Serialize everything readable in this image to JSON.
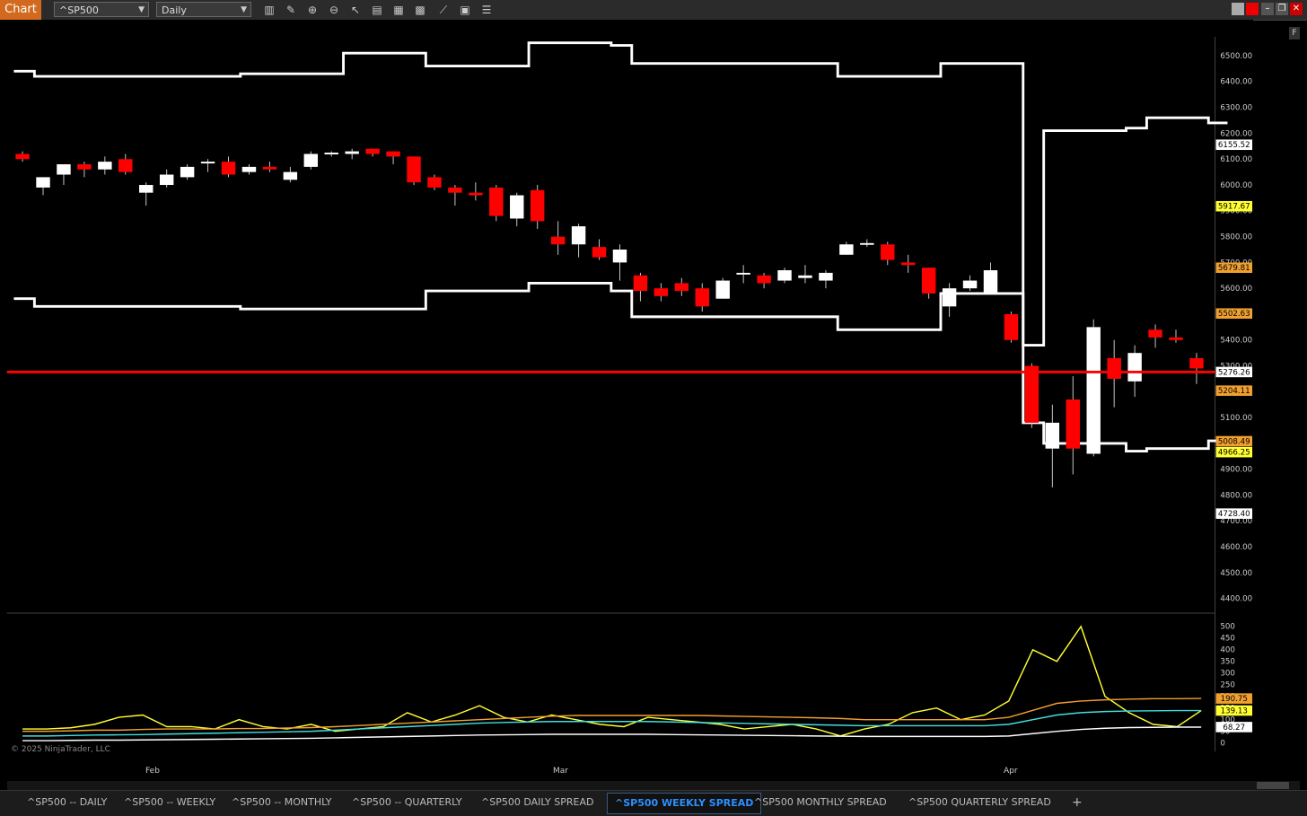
{
  "toolbar": {
    "app_label": "Chart",
    "instrument": "^SP500",
    "interval": "Daily",
    "right_button": "F"
  },
  "x_axis": {
    "labels": [
      "Feb",
      "Mar",
      "Apr"
    ]
  },
  "price_axis": {
    "ticks": [
      "6500.00",
      "6400.00",
      "6300.00",
      "6200.00",
      "6100.00",
      "6000.00",
      "5900.00",
      "5800.00",
      "5700.00",
      "5600.00",
      "5500.00",
      "5400.00",
      "5300.00",
      "5200.00",
      "5100.00",
      "5000.00",
      "4900.00",
      "4800.00",
      "4700.00",
      "4600.00",
      "4500.00",
      "4400.00"
    ],
    "tags": [
      {
        "text": "6155.52",
        "color": "#ffffff"
      },
      {
        "text": "5917.67",
        "color": "#ffff33"
      },
      {
        "text": "5679.81",
        "color": "#f0a030"
      },
      {
        "text": "5502.63",
        "color": "#f0a030"
      },
      {
        "text": "5276.26",
        "color": "#ffffff"
      },
      {
        "text": "5204.11",
        "color": "#f0a030"
      },
      {
        "text": "5008.49",
        "color": "#f0a030"
      },
      {
        "text": "4966.25",
        "color": "#ffff33"
      },
      {
        "text": "4728.40",
        "color": "#ffffff"
      }
    ]
  },
  "indicator_axis": {
    "ticks": [
      "500",
      "450",
      "400",
      "350",
      "300",
      "250",
      "200",
      "150",
      "100",
      "50",
      "0"
    ],
    "tags": [
      {
        "text": "190.75",
        "color": "#f0a030"
      },
      {
        "text": "139.13",
        "color": "#ffff33"
      },
      {
        "text": "68.27",
        "color": "#ffffff"
      }
    ]
  },
  "copyright": "© 2025 NinjaTrader, LLC",
  "tabs": [
    {
      "label": "^SP500 -- DAILY",
      "active": false
    },
    {
      "label": "^SP500 -- WEEKLY",
      "active": false
    },
    {
      "label": "^SP500 -- MONTHLY",
      "active": false
    },
    {
      "label": "^SP500 -- QUARTERLY",
      "active": false
    },
    {
      "label": "^SP500 DAILY SPREAD",
      "active": false
    },
    {
      "label": "^SP500 WEEKLY SPREAD",
      "active": true
    },
    {
      "label": "^SP500 MONTHLY SPREAD",
      "active": false
    },
    {
      "label": "^SP500 QUARTERLY SPREAD",
      "active": false
    }
  ],
  "add_tab": "+",
  "colors": {
    "up": "#ffffff",
    "down": "#ff0000",
    "level": "#ff0000",
    "band_white": "#ffffff",
    "band_yellow": "#ffff33",
    "band_orange": "#f0a030",
    "cyan": "#40e0e0"
  },
  "chart_data": {
    "type": "candlestick",
    "y_range": [
      4350,
      6560
    ],
    "current_price_line": 5276.26,
    "candles": [
      {
        "o": 6120,
        "h": 6130,
        "l": 6090,
        "c": 6100
      },
      {
        "o": 5990,
        "h": 6030,
        "l": 5960,
        "c": 6030
      },
      {
        "o": 6040,
        "h": 6080,
        "l": 6000,
        "c": 6080
      },
      {
        "o": 6080,
        "h": 6090,
        "l": 6030,
        "c": 6060
      },
      {
        "o": 6060,
        "h": 6110,
        "l": 6040,
        "c": 6090
      },
      {
        "o": 6100,
        "h": 6120,
        "l": 6040,
        "c": 6050
      },
      {
        "o": 5970,
        "h": 6010,
        "l": 5920,
        "c": 6000
      },
      {
        "o": 6000,
        "h": 6060,
        "l": 5990,
        "c": 6040
      },
      {
        "o": 6030,
        "h": 6080,
        "l": 6020,
        "c": 6070
      },
      {
        "o": 6090,
        "h": 6100,
        "l": 6050,
        "c": 6090
      },
      {
        "o": 6090,
        "h": 6110,
        "l": 6030,
        "c": 6040
      },
      {
        "o": 6050,
        "h": 6080,
        "l": 6040,
        "c": 6070
      },
      {
        "o": 6070,
        "h": 6090,
        "l": 6050,
        "c": 6060
      },
      {
        "o": 6020,
        "h": 6070,
        "l": 6010,
        "c": 6050
      },
      {
        "o": 6070,
        "h": 6130,
        "l": 6060,
        "c": 6120
      },
      {
        "o": 6120,
        "h": 6130,
        "l": 6110,
        "c": 6125
      },
      {
        "o": 6120,
        "h": 6140,
        "l": 6100,
        "c": 6130
      },
      {
        "o": 6140,
        "h": 6140,
        "l": 6110,
        "c": 6120
      },
      {
        "o": 6130,
        "h": 6130,
        "l": 6080,
        "c": 6110
      },
      {
        "o": 6110,
        "h": 6110,
        "l": 6000,
        "c": 6010
      },
      {
        "o": 6030,
        "h": 6040,
        "l": 5980,
        "c": 5990
      },
      {
        "o": 5990,
        "h": 6000,
        "l": 5920,
        "c": 5970
      },
      {
        "o": 5970,
        "h": 6010,
        "l": 5940,
        "c": 5960
      },
      {
        "o": 5990,
        "h": 6000,
        "l": 5860,
        "c": 5880
      },
      {
        "o": 5870,
        "h": 5970,
        "l": 5840,
        "c": 5960
      },
      {
        "o": 5980,
        "h": 6000,
        "l": 5830,
        "c": 5860
      },
      {
        "o": 5800,
        "h": 5860,
        "l": 5730,
        "c": 5770
      },
      {
        "o": 5770,
        "h": 5850,
        "l": 5720,
        "c": 5840
      },
      {
        "o": 5760,
        "h": 5790,
        "l": 5710,
        "c": 5720
      },
      {
        "o": 5700,
        "h": 5770,
        "l": 5630,
        "c": 5750
      },
      {
        "o": 5650,
        "h": 5660,
        "l": 5550,
        "c": 5590
      },
      {
        "o": 5600,
        "h": 5620,
        "l": 5550,
        "c": 5570
      },
      {
        "o": 5620,
        "h": 5640,
        "l": 5570,
        "c": 5590
      },
      {
        "o": 5600,
        "h": 5620,
        "l": 5510,
        "c": 5530
      },
      {
        "o": 5560,
        "h": 5640,
        "l": 5560,
        "c": 5630
      },
      {
        "o": 5660,
        "h": 5690,
        "l": 5620,
        "c": 5660
      },
      {
        "o": 5650,
        "h": 5660,
        "l": 5600,
        "c": 5620
      },
      {
        "o": 5630,
        "h": 5680,
        "l": 5620,
        "c": 5670
      },
      {
        "o": 5640,
        "h": 5690,
        "l": 5620,
        "c": 5650
      },
      {
        "o": 5630,
        "h": 5670,
        "l": 5600,
        "c": 5660
      },
      {
        "o": 5730,
        "h": 5780,
        "l": 5730,
        "c": 5770
      },
      {
        "o": 5770,
        "h": 5790,
        "l": 5760,
        "c": 5775
      },
      {
        "o": 5770,
        "h": 5780,
        "l": 5690,
        "c": 5710
      },
      {
        "o": 5700,
        "h": 5730,
        "l": 5660,
        "c": 5690
      },
      {
        "o": 5680,
        "h": 5680,
        "l": 5560,
        "c": 5580
      },
      {
        "o": 5530,
        "h": 5620,
        "l": 5490,
        "c": 5600
      },
      {
        "o": 5600,
        "h": 5650,
        "l": 5590,
        "c": 5630
      },
      {
        "o": 5580,
        "h": 5700,
        "l": 5580,
        "c": 5670
      },
      {
        "o": 5500,
        "h": 5510,
        "l": 5390,
        "c": 5400
      },
      {
        "o": 5300,
        "h": 5310,
        "l": 5060,
        "c": 5080
      },
      {
        "o": 4980,
        "h": 5150,
        "l": 4830,
        "c": 5080
      },
      {
        "o": 5170,
        "h": 5260,
        "l": 4880,
        "c": 4980
      },
      {
        "o": 4960,
        "h": 5480,
        "l": 4950,
        "c": 5450
      },
      {
        "o": 5330,
        "h": 5400,
        "l": 5140,
        "c": 5250
      },
      {
        "o": 5240,
        "h": 5380,
        "l": 5180,
        "c": 5350
      },
      {
        "o": 5440,
        "h": 5460,
        "l": 5370,
        "c": 5410
      },
      {
        "o": 5410,
        "h": 5440,
        "l": 5390,
        "c": 5400
      },
      {
        "o": 5330,
        "h": 5350,
        "l": 5230,
        "c": 5290
      }
    ],
    "bands": [
      {
        "color": "white",
        "x": [
          0,
          1,
          5,
          11,
          16,
          20,
          25,
          29,
          30,
          35,
          40,
          45,
          49,
          50,
          54,
          55,
          58
        ],
        "y": [
          6440,
          6420,
          6420,
          6430,
          6510,
          6460,
          6550,
          6540,
          6470,
          6470,
          6420,
          6470,
          5380,
          6210,
          6220,
          6260,
          6240
        ]
      },
      {
        "color": "white",
        "x": [
          0,
          1,
          5,
          11,
          16,
          20,
          25,
          29,
          30,
          35,
          40,
          45,
          49,
          50,
          54,
          55,
          58
        ],
        "y": [
          5560,
          5530,
          5530,
          5520,
          5520,
          5590,
          5620,
          5590,
          5490,
          5490,
          5440,
          5580,
          5080,
          5000,
          4970,
          4980,
          5010
        ]
      }
    ],
    "indicator": {
      "y_range": [
        0,
        520
      ],
      "series": [
        {
          "color": "#ffff33",
          "values": [
            60,
            60,
            65,
            80,
            110,
            120,
            70,
            70,
            60,
            100,
            70,
            60,
            80,
            50,
            60,
            70,
            130,
            90,
            120,
            160,
            110,
            90,
            120,
            100,
            80,
            70,
            110,
            100,
            90,
            80,
            60,
            70,
            80,
            60,
            30,
            60,
            80,
            130,
            150,
            100,
            120,
            180,
            400,
            350,
            500,
            200,
            130,
            80,
            70,
            139
          ]
        },
        {
          "color": "#f0a030",
          "values": [
            50,
            50,
            52,
            55,
            55,
            58,
            60,
            60,
            60,
            62,
            62,
            64,
            66,
            70,
            75,
            80,
            85,
            90,
            95,
            100,
            105,
            110,
            115,
            118,
            118,
            118,
            118,
            118,
            118,
            116,
            114,
            112,
            110,
            108,
            105,
            100,
            100,
            100,
            100,
            100,
            100,
            110,
            140,
            170,
            180,
            185,
            188,
            190,
            190,
            191
          ]
        },
        {
          "color": "#40e0e0",
          "values": [
            30,
            30,
            32,
            34,
            35,
            36,
            38,
            40,
            42,
            44,
            46,
            48,
            50,
            55,
            60,
            65,
            70,
            75,
            80,
            85,
            88,
            90,
            92,
            92,
            92,
            92,
            92,
            90,
            88,
            86,
            84,
            82,
            80,
            78,
            76,
            74,
            74,
            74,
            74,
            74,
            74,
            80,
            100,
            120,
            130,
            135,
            137,
            138,
            139,
            139
          ]
        },
        {
          "color": "#ffffff",
          "values": [
            10,
            10,
            11,
            12,
            12,
            13,
            14,
            15,
            16,
            17,
            18,
            19,
            20,
            22,
            24,
            26,
            28,
            30,
            32,
            34,
            35,
            36,
            37,
            37,
            37,
            37,
            37,
            36,
            35,
            34,
            33,
            32,
            31,
            30,
            29,
            28,
            28,
            28,
            28,
            28,
            28,
            30,
            40,
            50,
            58,
            63,
            66,
            67,
            68,
            68
          ]
        }
      ]
    }
  }
}
